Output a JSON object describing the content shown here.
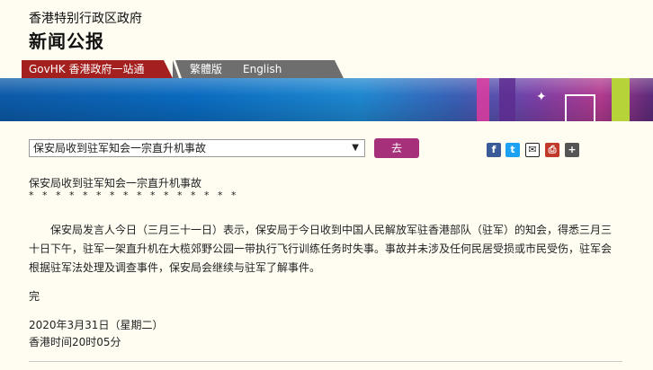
{
  "header": {
    "org": "香港特别行政区政府",
    "title": "新闻公报"
  },
  "nav": {
    "govhk": "GovHK 香港政府一站通",
    "traditional": "繁體版",
    "english": "English"
  },
  "toolbar": {
    "selected_article": "保安局收到驻军知会一宗直升机事故",
    "go_label": "去",
    "share_icons": [
      "facebook-icon",
      "twitter-icon",
      "email-icon",
      "print-icon",
      "bookmark-icon"
    ]
  },
  "article": {
    "title": "保安局收到驻军知会一宗直升机事故",
    "stars": "* * * * * * * * * * * * * * * *",
    "body": "保安局发言人今日（三月三十一日）表示，保安局于今日收到中国人民解放军驻香港部队（驻军）的知会，得悉三月三十日下午，驻军一架直升机在大榄郊野公园一带执行飞行训练任务时失事。事故并未涉及任何民居受损或市民受伤，驻军会根据驻军法处理及调查事件，保安局会继续与驻军了解事件。",
    "end": "完",
    "date": "2020年3月31日（星期二）",
    "time": "香港时间20时05分"
  },
  "colors": {
    "nav_red": "#a3201f",
    "go_button": "#a6307a",
    "background": "#fffdf2"
  }
}
